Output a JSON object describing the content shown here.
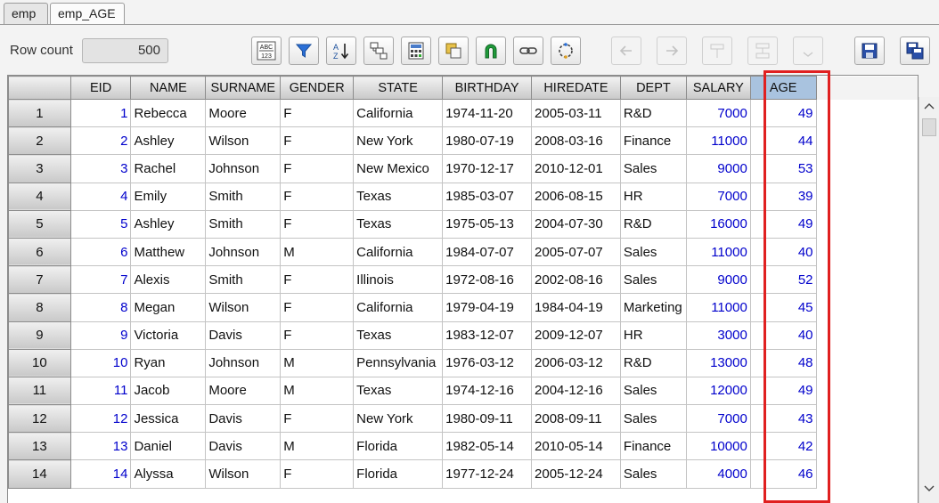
{
  "tabs": [
    {
      "label": "emp",
      "active": false
    },
    {
      "label": "emp_AGE",
      "active": true
    }
  ],
  "toolbar": {
    "row_count_label": "Row count",
    "row_count_value": "500",
    "buttons": [
      {
        "name": "abc-123-icon",
        "enabled": true
      },
      {
        "name": "filter-icon",
        "enabled": true
      },
      {
        "name": "sort-az-icon",
        "enabled": true
      },
      {
        "name": "group-icon",
        "enabled": true
      },
      {
        "name": "calculator-icon",
        "enabled": true
      },
      {
        "name": "copy-icon",
        "enabled": true
      },
      {
        "name": "magnet-icon",
        "enabled": true
      },
      {
        "name": "link-icon",
        "enabled": true
      },
      {
        "name": "refresh-icon",
        "enabled": true
      },
      {
        "name": "arrow-left-icon",
        "enabled": false
      },
      {
        "name": "arrow-right-icon",
        "enabled": false
      },
      {
        "name": "insert-column-icon",
        "enabled": false
      },
      {
        "name": "split-column-icon",
        "enabled": false
      },
      {
        "name": "chevron-down-icon",
        "enabled": false
      },
      {
        "name": "save-icon",
        "enabled": true
      },
      {
        "name": "save-as-icon",
        "enabled": true
      }
    ]
  },
  "grid": {
    "columns": [
      "EID",
      "NAME",
      "SURNAME",
      "GENDER",
      "STATE",
      "BIRTHDAY",
      "HIREDATE",
      "DEPT",
      "SALARY",
      "AGE"
    ],
    "selected_column": "AGE",
    "highlight_color": "#e02020",
    "rows": [
      {
        "row": "1",
        "cells": [
          "1",
          "Rebecca",
          "Moore",
          "F",
          "California",
          "1974-11-20",
          "2005-03-11",
          "R&D",
          "7000",
          "49"
        ]
      },
      {
        "row": "2",
        "cells": [
          "2",
          "Ashley",
          "Wilson",
          "F",
          "New York",
          "1980-07-19",
          "2008-03-16",
          "Finance",
          "11000",
          "44"
        ]
      },
      {
        "row": "3",
        "cells": [
          "3",
          "Rachel",
          "Johnson",
          "F",
          "New Mexico",
          "1970-12-17",
          "2010-12-01",
          "Sales",
          "9000",
          "53"
        ]
      },
      {
        "row": "4",
        "cells": [
          "4",
          "Emily",
          "Smith",
          "F",
          "Texas",
          "1985-03-07",
          "2006-08-15",
          "HR",
          "7000",
          "39"
        ]
      },
      {
        "row": "5",
        "cells": [
          "5",
          "Ashley",
          "Smith",
          "F",
          "Texas",
          "1975-05-13",
          "2004-07-30",
          "R&D",
          "16000",
          "49"
        ]
      },
      {
        "row": "6",
        "cells": [
          "6",
          "Matthew",
          "Johnson",
          "M",
          "California",
          "1984-07-07",
          "2005-07-07",
          "Sales",
          "11000",
          "40"
        ]
      },
      {
        "row": "7",
        "cells": [
          "7",
          "Alexis",
          "Smith",
          "F",
          "Illinois",
          "1972-08-16",
          "2002-08-16",
          "Sales",
          "9000",
          "52"
        ]
      },
      {
        "row": "8",
        "cells": [
          "8",
          "Megan",
          "Wilson",
          "F",
          "California",
          "1979-04-19",
          "1984-04-19",
          "Marketing",
          "11000",
          "45"
        ]
      },
      {
        "row": "9",
        "cells": [
          "9",
          "Victoria",
          "Davis",
          "F",
          "Texas",
          "1983-12-07",
          "2009-12-07",
          "HR",
          "3000",
          "40"
        ]
      },
      {
        "row": "10",
        "cells": [
          "10",
          "Ryan",
          "Johnson",
          "M",
          "Pennsylvania",
          "1976-03-12",
          "2006-03-12",
          "R&D",
          "13000",
          "48"
        ]
      },
      {
        "row": "11",
        "cells": [
          "11",
          "Jacob",
          "Moore",
          "M",
          "Texas",
          "1974-12-16",
          "2004-12-16",
          "Sales",
          "12000",
          "49"
        ]
      },
      {
        "row": "12",
        "cells": [
          "12",
          "Jessica",
          "Davis",
          "F",
          "New York",
          "1980-09-11",
          "2008-09-11",
          "Sales",
          "7000",
          "43"
        ]
      },
      {
        "row": "13",
        "cells": [
          "13",
          "Daniel",
          "Davis",
          "M",
          "Florida",
          "1982-05-14",
          "2010-05-14",
          "Finance",
          "10000",
          "42"
        ]
      },
      {
        "row": "14",
        "cells": [
          "14",
          "Alyssa",
          "Wilson",
          "F",
          "Florida",
          "1977-12-24",
          "2005-12-24",
          "Sales",
          "4000",
          "46"
        ]
      }
    ]
  }
}
